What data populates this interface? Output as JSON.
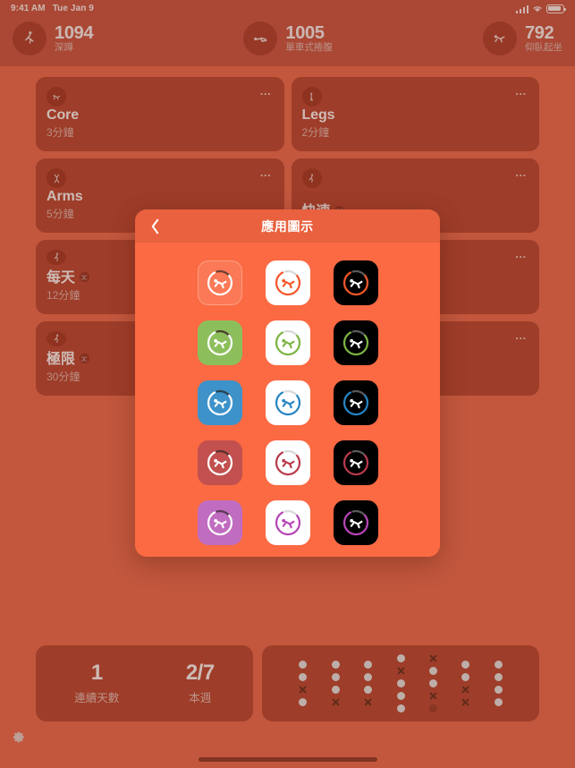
{
  "status_bar": {
    "time": "9:41 AM",
    "date": "Tue Jan 9",
    "icons": [
      "cellular-signal-icon",
      "wifi-icon",
      "battery-icon"
    ]
  },
  "top_stats": [
    {
      "icon": "squat-figure-icon",
      "count": "1094",
      "label": "深蹲"
    },
    {
      "icon": "bicycle-crunch-icon",
      "count": "1005",
      "label": "單車式捲腹"
    },
    {
      "icon": "situp-figure-icon",
      "count": "792",
      "label": "仰臥起坐"
    }
  ],
  "workout_cards": [
    {
      "icon": "situp-figure-icon",
      "title": "Core",
      "duration": "3分鐘",
      "shuffle": false,
      "menu": "…"
    },
    {
      "icon": "standing-figure-icon",
      "title": "Legs",
      "duration": "2分鐘",
      "shuffle": false,
      "menu": "…"
    },
    {
      "icon": "arms-figure-icon",
      "title": "Arms",
      "duration": "5分鐘",
      "shuffle": false,
      "menu": "…"
    },
    {
      "icon": "running-figure-icon",
      "title": "快速",
      "duration": "",
      "shuffle": true,
      "menu": "…"
    },
    {
      "icon": "running-figure-icon",
      "title": "每天",
      "duration": "12分鐘",
      "shuffle": true,
      "menu": "…"
    },
    {
      "icon": "running-figure-icon",
      "title": "極限",
      "duration": "30分鐘",
      "shuffle": true,
      "menu": "…"
    }
  ],
  "bottom_stats": {
    "streak": {
      "value": "1",
      "label": "連續天數"
    },
    "week": {
      "value": "2/7",
      "label": "本週"
    }
  },
  "history_grid": {
    "legend": {
      "dot": "completed-day",
      "x": "missed-day",
      "faint": "future-day"
    },
    "columns": [
      [
        "dot",
        "dot",
        "x",
        "dot"
      ],
      [
        "dot",
        "dot",
        "dot",
        "x"
      ],
      [
        "dot",
        "dot",
        "dot",
        "x"
      ],
      [
        "dot",
        "x",
        "dot",
        "dot",
        "dot"
      ],
      [
        "x",
        "dot",
        "dot",
        "x",
        "faint"
      ],
      [
        "dot",
        "dot",
        "x",
        "x"
      ],
      [
        "dot",
        "dot",
        "dot",
        "dot"
      ]
    ]
  },
  "settings_button": {
    "icon": "gear-icon",
    "label": ""
  },
  "modal": {
    "title": "應用圖示",
    "back_icon": "chevron-left-icon",
    "background": "#fb6a43",
    "header_background": "#e9613e",
    "icon_rows": [
      {
        "accent": "#ffffff",
        "variants": [
          {
            "style": "tinted",
            "bg": "rgba(255,255,255,0.10)",
            "ring": "#ffffff",
            "ring_dark": "#6d4033",
            "figure": "#ffffff"
          },
          {
            "style": "light",
            "bg": "#ffffff",
            "ring": "#f4572a",
            "ring_dark": "#d9d9d9",
            "figure": "#f4572a"
          },
          {
            "style": "dark",
            "bg": "#000000",
            "ring": "#f4572a",
            "ring_dark": "#5a5a5a",
            "figure": "#ffffff"
          }
        ]
      },
      {
        "accent": "#8cbf5c",
        "variants": [
          {
            "style": "tinted",
            "bg": "#8cbf5c",
            "ring": "#ffffff",
            "ring_dark": "#4a4030",
            "figure": "#ffffff"
          },
          {
            "style": "light",
            "bg": "#ffffff",
            "ring": "#7cb342",
            "ring_dark": "#d9d9d9",
            "figure": "#7cb342"
          },
          {
            "style": "dark",
            "bg": "#000000",
            "ring": "#7cb342",
            "ring_dark": "#5a5a5a",
            "figure": "#ffffff"
          }
        ]
      },
      {
        "accent": "#3d92c9",
        "variants": [
          {
            "style": "tinted",
            "bg": "#3d92c9",
            "ring": "#ffffff",
            "ring_dark": "#2d4250",
            "figure": "#ffffff"
          },
          {
            "style": "light",
            "bg": "#ffffff",
            "ring": "#2585c4",
            "ring_dark": "#d9d9d9",
            "figure": "#2585c4"
          },
          {
            "style": "dark",
            "bg": "#000000",
            "ring": "#2585c4",
            "ring_dark": "#5a5a5a",
            "figure": "#ffffff"
          }
        ]
      },
      {
        "accent": "#c1504e",
        "variants": [
          {
            "style": "tinted",
            "bg": "#c1504e",
            "ring": "#ffffff",
            "ring_dark": "#5a3230",
            "figure": "#ffffff"
          },
          {
            "style": "light",
            "bg": "#ffffff",
            "ring": "#b93a4b",
            "ring_dark": "#d9d9d9",
            "figure": "#b93a4b"
          },
          {
            "style": "dark",
            "bg": "#000000",
            "ring": "#b93a4b",
            "ring_dark": "#5a5a5a",
            "figure": "#ffffff"
          }
        ]
      },
      {
        "accent": "#c06cc0",
        "variants": [
          {
            "style": "tinted",
            "bg": "#c06cc0",
            "ring": "#ffffff",
            "ring_dark": "#5a3a58",
            "figure": "#ffffff"
          },
          {
            "style": "light",
            "bg": "#ffffff",
            "ring": "#b745b7",
            "ring_dark": "#d9d9d9",
            "figure": "#b745b7"
          },
          {
            "style": "dark",
            "bg": "#000000",
            "ring": "#b745b7",
            "ring_dark": "#5a5a5a",
            "figure": "#ffffff"
          }
        ]
      }
    ]
  }
}
